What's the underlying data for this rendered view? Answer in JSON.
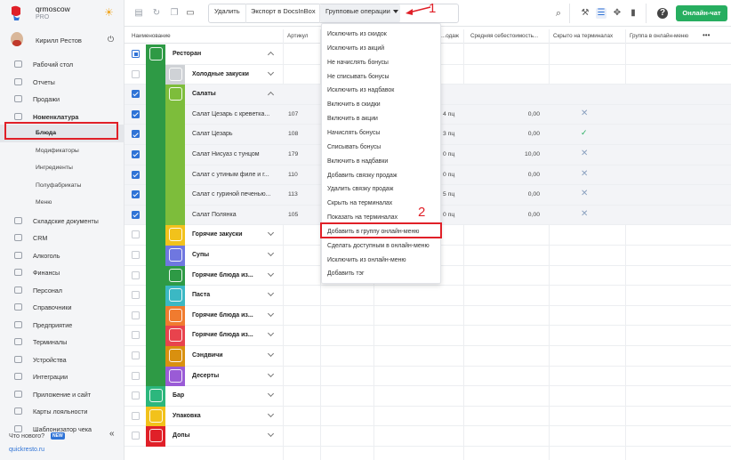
{
  "brand": {
    "name": "qrmoscow",
    "plan": "PRO"
  },
  "user": {
    "name": "Кирилл Рестов"
  },
  "sidebar": {
    "items": [
      {
        "label": "Рабочий стол",
        "type": "top",
        "icon": "desktop-icon"
      },
      {
        "label": "Отчеты",
        "type": "top",
        "icon": "chart-icon"
      },
      {
        "label": "Продажи",
        "type": "top",
        "icon": "cart-icon"
      },
      {
        "label": "Номенклатура",
        "type": "bold",
        "icon": "tag-icon"
      },
      {
        "label": "Блюда",
        "type": "sub-active",
        "icon": ""
      },
      {
        "label": "Модификаторы",
        "type": "sub",
        "icon": ""
      },
      {
        "label": "Ингредиенты",
        "type": "sub",
        "icon": ""
      },
      {
        "label": "Полуфабрикаты",
        "type": "sub",
        "icon": ""
      },
      {
        "label": "Меню",
        "type": "sub",
        "icon": ""
      },
      {
        "label": "Складские документы",
        "type": "top",
        "icon": "warehouse-icon"
      },
      {
        "label": "CRM",
        "type": "top",
        "icon": "crm-icon"
      },
      {
        "label": "Алкоголь",
        "type": "top",
        "icon": "wine-icon"
      },
      {
        "label": "Финансы",
        "type": "top",
        "icon": "wallet-icon"
      },
      {
        "label": "Персонал",
        "type": "top",
        "icon": "people-icon"
      },
      {
        "label": "Справочники",
        "type": "top",
        "icon": "book-icon"
      },
      {
        "label": "Предприятие",
        "type": "top",
        "icon": "building-icon"
      },
      {
        "label": "Терминалы",
        "type": "top",
        "icon": "terminal-icon"
      },
      {
        "label": "Устройства",
        "type": "top",
        "icon": "devices-icon"
      },
      {
        "label": "Интеграции",
        "type": "top",
        "icon": "link-icon"
      },
      {
        "label": "Приложение и сайт",
        "type": "top",
        "icon": "app-icon"
      },
      {
        "label": "Карты лояльности",
        "type": "top",
        "icon": "card-icon"
      },
      {
        "label": "Шаблонизатор чека",
        "type": "top",
        "icon": "receipt-icon"
      }
    ],
    "whats_new": "Что нового?",
    "new_badge": "NEW",
    "collapse": "«",
    "site": "quickresto.ru"
  },
  "toolbar": {
    "delete": "Удалить",
    "export": "Экспорт в DocsInBox",
    "group_ops": "Групповые операции",
    "chat": "Онлайн-чат"
  },
  "annotations": {
    "first": "1",
    "second": "2"
  },
  "table": {
    "columns": {
      "name": "Наименование",
      "article": "Артикул",
      "sold": "...одаж",
      "cost": "Средняя себестоимость...",
      "hidden": "Скрыто на терминалах",
      "online_group": "Группа в онлайн-меню",
      "more": "•••"
    },
    "rows": [
      {
        "name": "Ресторан",
        "level": 0,
        "check": "part",
        "bold": true,
        "color": "#2e9a45",
        "chev": "up",
        "sel": false
      },
      {
        "name": "Холодные закуски",
        "level": 1,
        "check": "off",
        "bold": true,
        "color": "#cfd2d6",
        "chev": "down",
        "sel": false
      },
      {
        "name": "Салаты",
        "level": 1,
        "check": "on",
        "bold": true,
        "color": "#7dbd3b",
        "chev": "up",
        "sel": true
      },
      {
        "name": "Салат Цезарь с креветка...",
        "level": 2,
        "check": "on",
        "article": "107",
        "sold": "4 пц",
        "cost": "0,00",
        "hidden": "x",
        "sel": true
      },
      {
        "name": "Салат Цезарь",
        "level": 2,
        "check": "on",
        "article": "108",
        "sold": "3 пц",
        "cost": "0,00",
        "hidden": "ok",
        "sel": true
      },
      {
        "name": "Салат Нисуаз с тунцом",
        "level": 2,
        "check": "on",
        "article": "179",
        "sold": "0 пц",
        "cost": "10,00",
        "hidden": "x",
        "sel": true
      },
      {
        "name": "Салат с утиным филе и г...",
        "level": 2,
        "check": "on",
        "article": "110",
        "sold": "0 пц",
        "cost": "0,00",
        "hidden": "x",
        "sel": true
      },
      {
        "name": "Салат с гуриной печенью...",
        "level": 2,
        "check": "on",
        "article": "113",
        "sold": "5 пц",
        "cost": "0,00",
        "hidden": "x",
        "sel": true
      },
      {
        "name": "Салат Полянка",
        "level": 2,
        "check": "on",
        "article": "105",
        "sold": "0 пц",
        "cost": "0,00",
        "hidden": "x",
        "sel": true
      },
      {
        "name": "Горячие закуски",
        "level": 1,
        "check": "off",
        "bold": true,
        "color": "#f2c21b",
        "chev": "down",
        "sel": false
      },
      {
        "name": "Супы",
        "level": 1,
        "check": "off",
        "bold": true,
        "color": "#6f77e0",
        "chev": "down",
        "sel": false
      },
      {
        "name": "Горячие блюда из...",
        "level": 1,
        "check": "off",
        "bold": true,
        "color": "#2e9a45",
        "chev": "down",
        "sel": false
      },
      {
        "name": "Паста",
        "level": 1,
        "check": "off",
        "bold": true,
        "color": "#3bb8c4",
        "chev": "down",
        "sel": false
      },
      {
        "name": "Горячие блюда из...",
        "level": 1,
        "check": "off",
        "bold": true,
        "color": "#f07b2f",
        "chev": "down",
        "sel": false
      },
      {
        "name": "Горячие блюда из...",
        "level": 1,
        "check": "off",
        "bold": true,
        "color": "#e8434d",
        "chev": "down",
        "sel": false
      },
      {
        "name": "Сэндвичи",
        "level": 1,
        "check": "off",
        "bold": true,
        "color": "#d9900f",
        "chev": "down",
        "sel": false
      },
      {
        "name": "Десерты",
        "level": 1,
        "check": "off",
        "bold": true,
        "color": "#9a5bd6",
        "chev": "down",
        "sel": false
      },
      {
        "name": "Бар",
        "level": 0,
        "check": "off",
        "bold": true,
        "color": "#2cb77d",
        "chev": "down",
        "sel": false
      },
      {
        "name": "Упаковка",
        "level": 0,
        "check": "off",
        "bold": true,
        "color": "#f2c21b",
        "chev": "down",
        "sel": false
      },
      {
        "name": "Допы",
        "level": 0,
        "check": "off",
        "bold": true,
        "color": "#e02028",
        "chev": "down",
        "sel": false
      }
    ]
  },
  "dropdown": {
    "items": [
      "Исключить из скидок",
      "Исключить из акций",
      "Не начислять бонусы",
      "Не списывать бонусы",
      "Исключить из надбавок",
      "Включить в скидки",
      "Включить в акции",
      "Начислять бонусы",
      "Списывать бонусы",
      "Включить в надбавки",
      "Добавить связку продаж",
      "Удалить связку продаж",
      "Скрыть на терминалах",
      "Показать на терминалах",
      "Добавить в группу онлайн-меню",
      "Сделать доступным в онлайн-меню",
      "Исключить из онлайн-меню",
      "Добавить тэг"
    ]
  },
  "colors": {
    "accent": "#2f73d6",
    "chat": "#27ae60",
    "highlight": "#e02028"
  }
}
